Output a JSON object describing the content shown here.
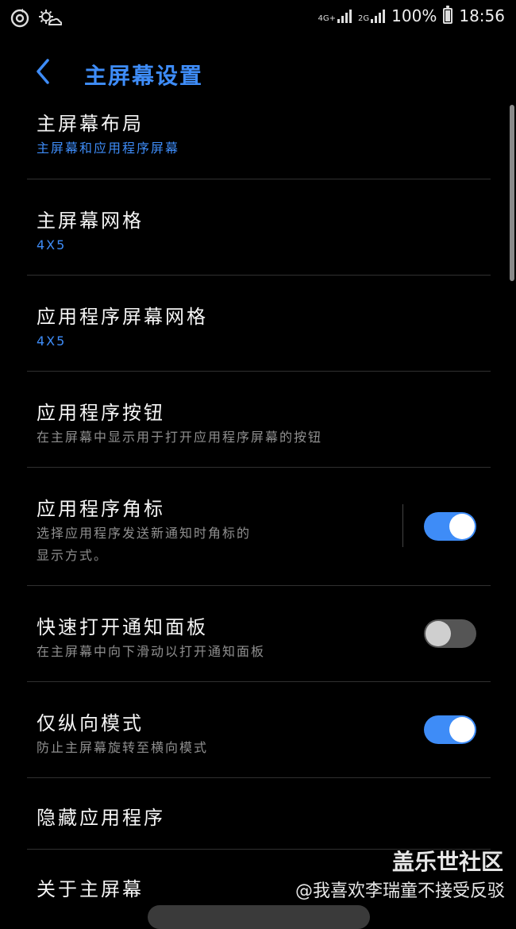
{
  "status_bar": {
    "net1": "4G+",
    "net2": "2G",
    "battery": "100%",
    "time": "18:56"
  },
  "header": {
    "title": "主屏幕设置"
  },
  "items": [
    {
      "title": "主屏幕布局",
      "subtitle": "主屏幕和应用程序屏幕",
      "subtitle_accent": true
    },
    {
      "title": "主屏幕网格",
      "subtitle": "4X5",
      "subtitle_accent": true
    },
    {
      "title": "应用程序屏幕网格",
      "subtitle": "4X5",
      "subtitle_accent": true
    },
    {
      "title": "应用程序按钮",
      "subtitle": "在主屏幕中显示用于打开应用程序屏幕的按钮"
    },
    {
      "title": "应用程序角标",
      "subtitle_line1": "选择应用程序发送新通知时角标的",
      "subtitle_line2": "显示方式。",
      "toggle": "on"
    },
    {
      "title": "快速打开通知面板",
      "subtitle": "在主屏幕中向下滑动以打开通知面板",
      "toggle": "off"
    },
    {
      "title": "仅纵向模式",
      "subtitle": "防止主屏幕旋转至横向模式",
      "toggle": "on"
    },
    {
      "title": "隐藏应用程序"
    },
    {
      "title": "关于主屏幕"
    }
  ],
  "watermark": {
    "brand": "盖乐世社区",
    "user": "@我喜欢李瑞童不接受反驳"
  },
  "colors": {
    "accent": "#3e8cf7",
    "background": "#000000"
  }
}
